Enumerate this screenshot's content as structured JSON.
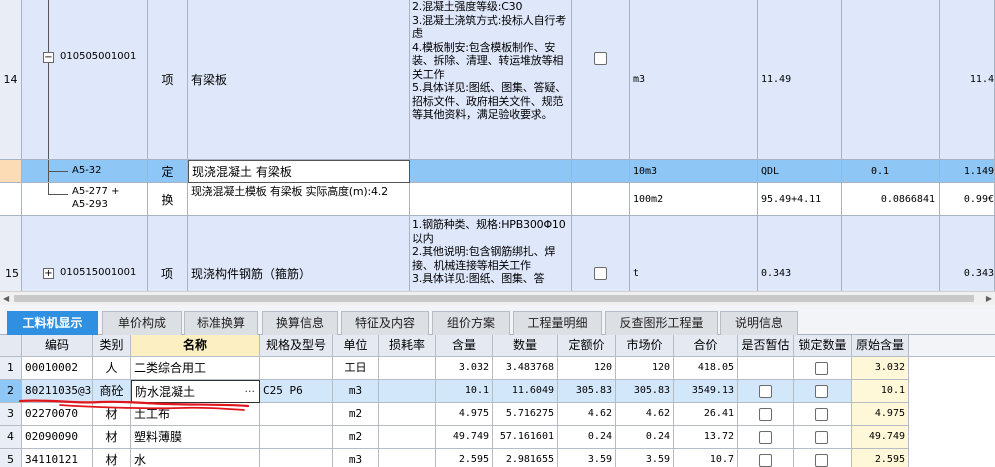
{
  "top_grid": {
    "row14": {
      "num": "14",
      "tree_toggle": "−",
      "code": "010505001001",
      "type": "项",
      "name": "有梁板",
      "desc": "2.混凝土强度等级:C30\n3.混凝土浇筑方式:投标人自行考虑\n4.模板制安:包含模板制作、安装、拆除、清理、转运堆放等相关工作\n5.具体详见:图纸、图集、答疑、招标文件、政府相关文件、规范等其他资料，满足验收要求。",
      "unit": "m3",
      "qty_expr": "11.49",
      "qty": "11.4"
    },
    "sub1": {
      "code": "A5-32",
      "type": "定",
      "name": "现浇混凝土 有梁板",
      "unit": "10m3",
      "qty_expr": "QDL",
      "coef": "0.1",
      "qty": "1.149"
    },
    "sub2": {
      "code": "A5-277 +\nA5-293",
      "type": "换",
      "name": "现浇混凝土模板 有梁板  实际高度(m):4.2",
      "unit": "100m2",
      "qty_expr": "95.49+4.11",
      "coef": "0.0866841",
      "qty": "0.99€"
    },
    "row15": {
      "num": "15",
      "tree_toggle": "+",
      "code": "010515001001",
      "type": "项",
      "name": "现浇构件钢筋（箍筋）",
      "desc": "1.钢筋种类、规格:HPB300Φ10以内\n2.其他说明:包含钢筋绑扎、焊接、机械连接等相关工作\n3.具体详见:图纸、图集、答",
      "unit": "t",
      "qty_expr": "0.343",
      "qty": "0.343"
    }
  },
  "tabs": [
    "工料机显示",
    "单价构成",
    "标准换算",
    "换算信息",
    "特征及内容",
    "组价方案",
    "工程量明细",
    "反查图形工程量",
    "说明信息"
  ],
  "bottom_grid": {
    "headers": [
      "编码",
      "类别",
      "名称",
      "规格及型号",
      "单位",
      "损耗率",
      "含量",
      "数量",
      "定额价",
      "市场价",
      "合价",
      "是否暂估",
      "锁定数量",
      "原始含量"
    ],
    "rows": [
      {
        "num": "1",
        "code": "00010002",
        "cat": "人",
        "name": "二类综合用工",
        "spec": "",
        "unit": "工日",
        "loss": "",
        "content": "3.032",
        "qty": "3.483768",
        "quota": "120",
        "market": "120",
        "total": "418.05",
        "orig": "3.032"
      },
      {
        "num": "2",
        "code": "80211035@3",
        "cat": "商砼",
        "name": "防水混凝土",
        "spec": "C25 P6",
        "unit": "m3",
        "loss": "",
        "content": "10.1",
        "qty": "11.6049",
        "quota": "305.83",
        "market": "305.83",
        "total": "3549.13",
        "orig": "10.1"
      },
      {
        "num": "3",
        "code": "02270070",
        "cat": "材",
        "name": "土工布",
        "spec": "",
        "unit": "m2",
        "loss": "",
        "content": "4.975",
        "qty": "5.716275",
        "quota": "4.62",
        "market": "4.62",
        "total": "26.41",
        "orig": "4.975"
      },
      {
        "num": "4",
        "code": "02090090",
        "cat": "材",
        "name": "塑料薄膜",
        "spec": "",
        "unit": "m2",
        "loss": "",
        "content": "49.749",
        "qty": "57.161601",
        "quota": "0.24",
        "market": "0.24",
        "total": "13.72",
        "orig": "49.749"
      },
      {
        "num": "5",
        "code": "34110121",
        "cat": "材",
        "name": "水",
        "spec": "",
        "unit": "m3",
        "loss": "",
        "content": "2.595",
        "qty": "2.981655",
        "quota": "3.59",
        "market": "3.59",
        "total": "10.7",
        "orig": "2.595"
      }
    ],
    "ellipsis_button": "···"
  },
  "colors": {
    "tab_active": "#2f8fe0",
    "row_selected": "#8ec6f5",
    "row_blue": "#dfe8fb",
    "annotation_red": "#e0161c"
  }
}
